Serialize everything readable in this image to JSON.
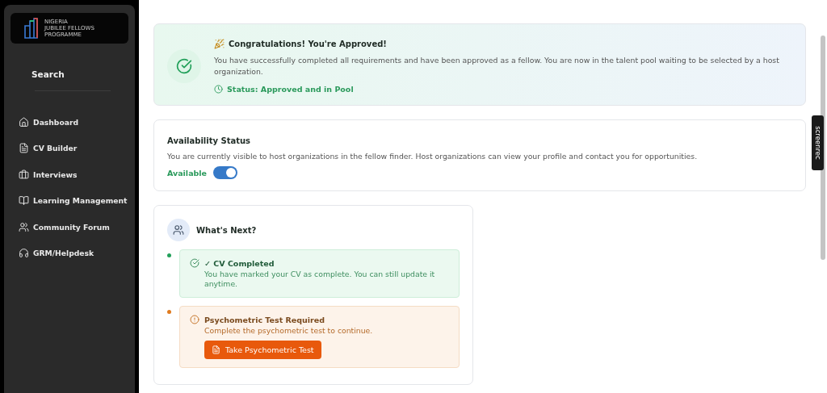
{
  "sidebar": {
    "logo_lines": [
      "NIGERIA",
      "JUBILEE FELLOWS",
      "PROGRAMME"
    ],
    "search": "Search",
    "items": [
      {
        "label": "Dashboard"
      },
      {
        "label": "CV Builder"
      },
      {
        "label": "Interviews"
      },
      {
        "label": "Learning Management"
      },
      {
        "label": "Community Forum"
      },
      {
        "label": "GRM/Helpdesk"
      }
    ]
  },
  "approval": {
    "title": "Congratulations! You're Approved!",
    "message": "You have successfully completed all requirements and have been approved as a fellow. You are now in the talent pool waiting to be selected by a host organization.",
    "status": "Status: Approved and in Pool"
  },
  "availability": {
    "title": "Availability Status",
    "message": "You are currently visible to host organizations in the fellow finder. Host organizations can view your profile and contact you for opportunities.",
    "label": "Available",
    "on": true
  },
  "next": {
    "title": "What's Next?",
    "steps": [
      {
        "kind": "done",
        "color": "#22a05a",
        "title": "✓ CV Completed",
        "message": "You have marked your CV as complete. You can still update it anytime."
      },
      {
        "kind": "required",
        "color": "#e07b1f",
        "title": "Psychometric Test Required",
        "message": "Complete the psychometric test to continue.",
        "button": "Take Psychometric Test"
      }
    ]
  },
  "recorder_tab": {
    "label": "screenrec"
  }
}
